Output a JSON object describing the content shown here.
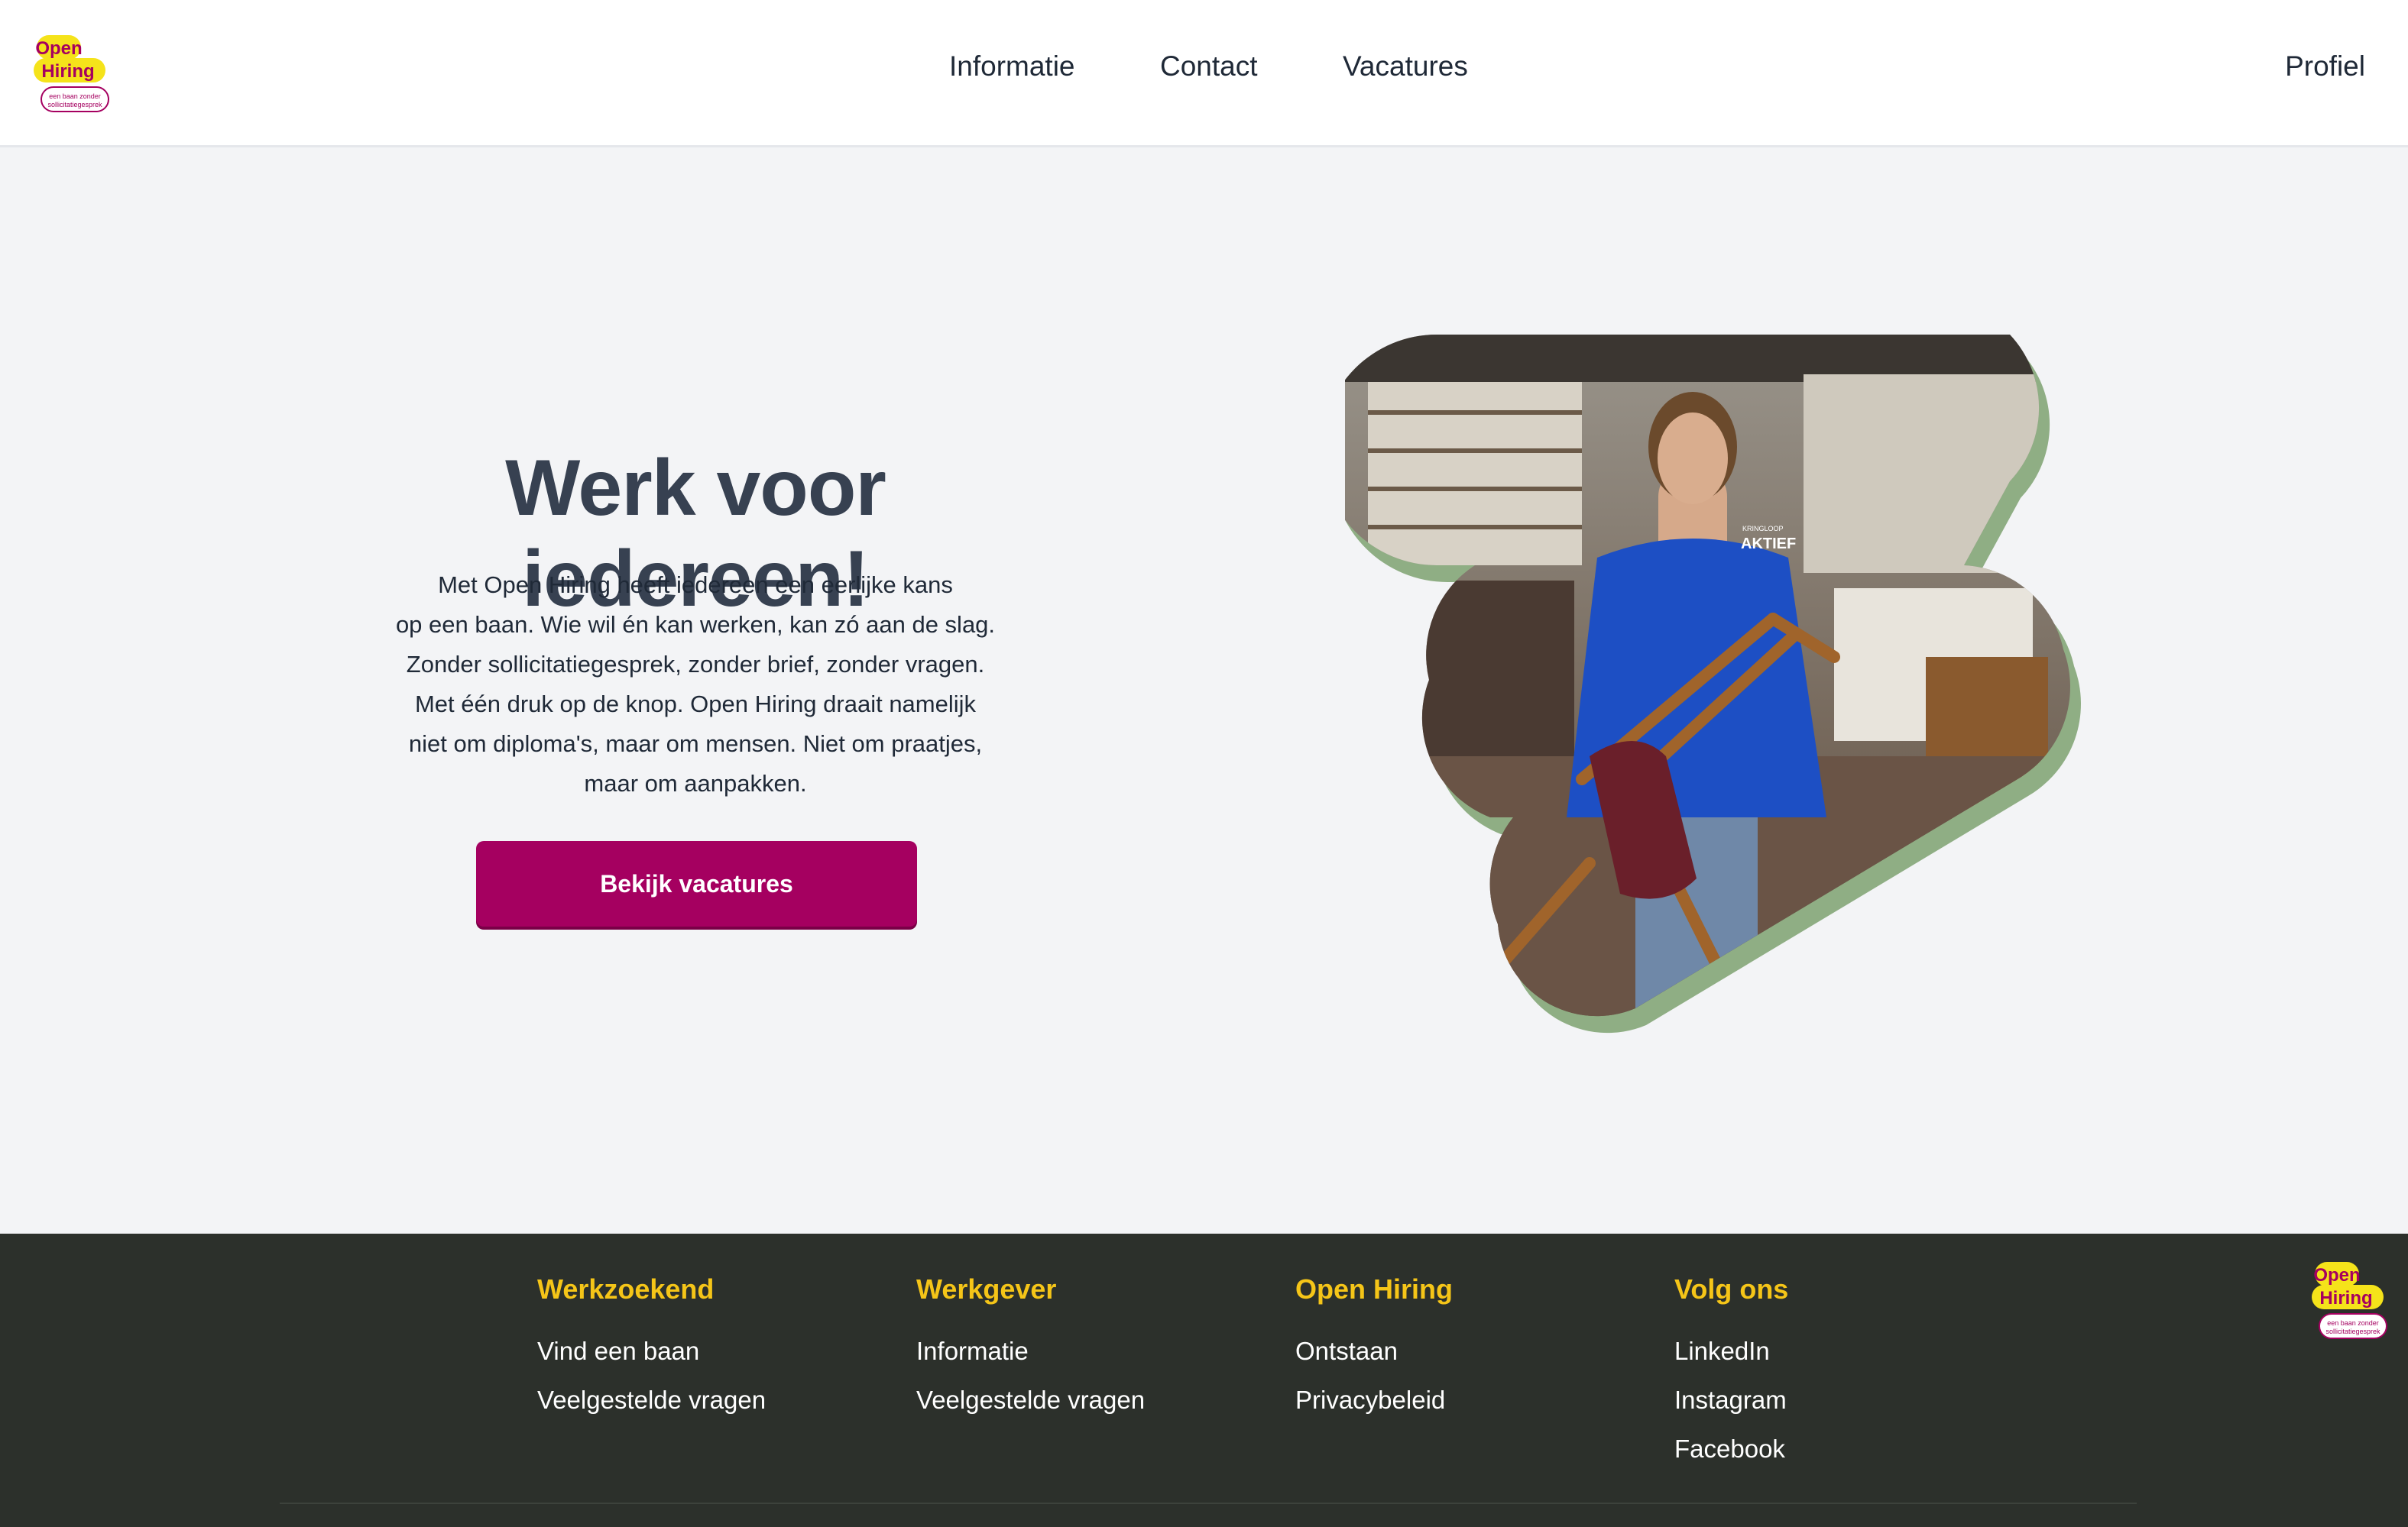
{
  "header": {
    "logo": {
      "line1": "Open",
      "line2": "Hiring",
      "tagline1": "een baan zonder",
      "tagline2": "sollicitatiegesprek"
    },
    "nav": {
      "informatie": "Informatie",
      "contact": "Contact",
      "vacatures": "Vacatures"
    },
    "profile": "Profiel"
  },
  "hero": {
    "title": "Werk voor iedereen!",
    "lines": [
      "Met Open Hiring heeft iedereen een eerlijke kans",
      "op een baan. Wie wil én kan werken, kan zó aan de slag.",
      "Zonder sollicitatiegesprek, zonder brief, zonder vragen.",
      "Met één druk op de knop. Open Hiring draait namelijk",
      "niet om diploma's, maar om mensen. Niet om praatjes,",
      "maar om aanpakken."
    ],
    "cta": "Bekijk vacatures",
    "jacket_text1": "KRINGLOOP",
    "jacket_text2": "AKTIEF"
  },
  "footer": {
    "columns": [
      {
        "title": "Werkzoekend",
        "links": [
          "Vind een baan",
          "Veelgestelde vragen"
        ]
      },
      {
        "title": "Werkgever",
        "links": [
          "Informatie",
          "Veelgestelde vragen"
        ]
      },
      {
        "title": "Open Hiring",
        "links": [
          "Ontstaan",
          "Privacybeleid"
        ]
      },
      {
        "title": "Volg ons",
        "links": [
          "LinkedIn",
          "Instagram",
          "Facebook"
        ]
      }
    ]
  },
  "colors": {
    "brand_magenta": "#a50060",
    "brand_yellow": "#f5e31a",
    "footer_bg": "#2c302b",
    "footer_heading": "#f5c518",
    "shape_green": "#8fae84"
  }
}
